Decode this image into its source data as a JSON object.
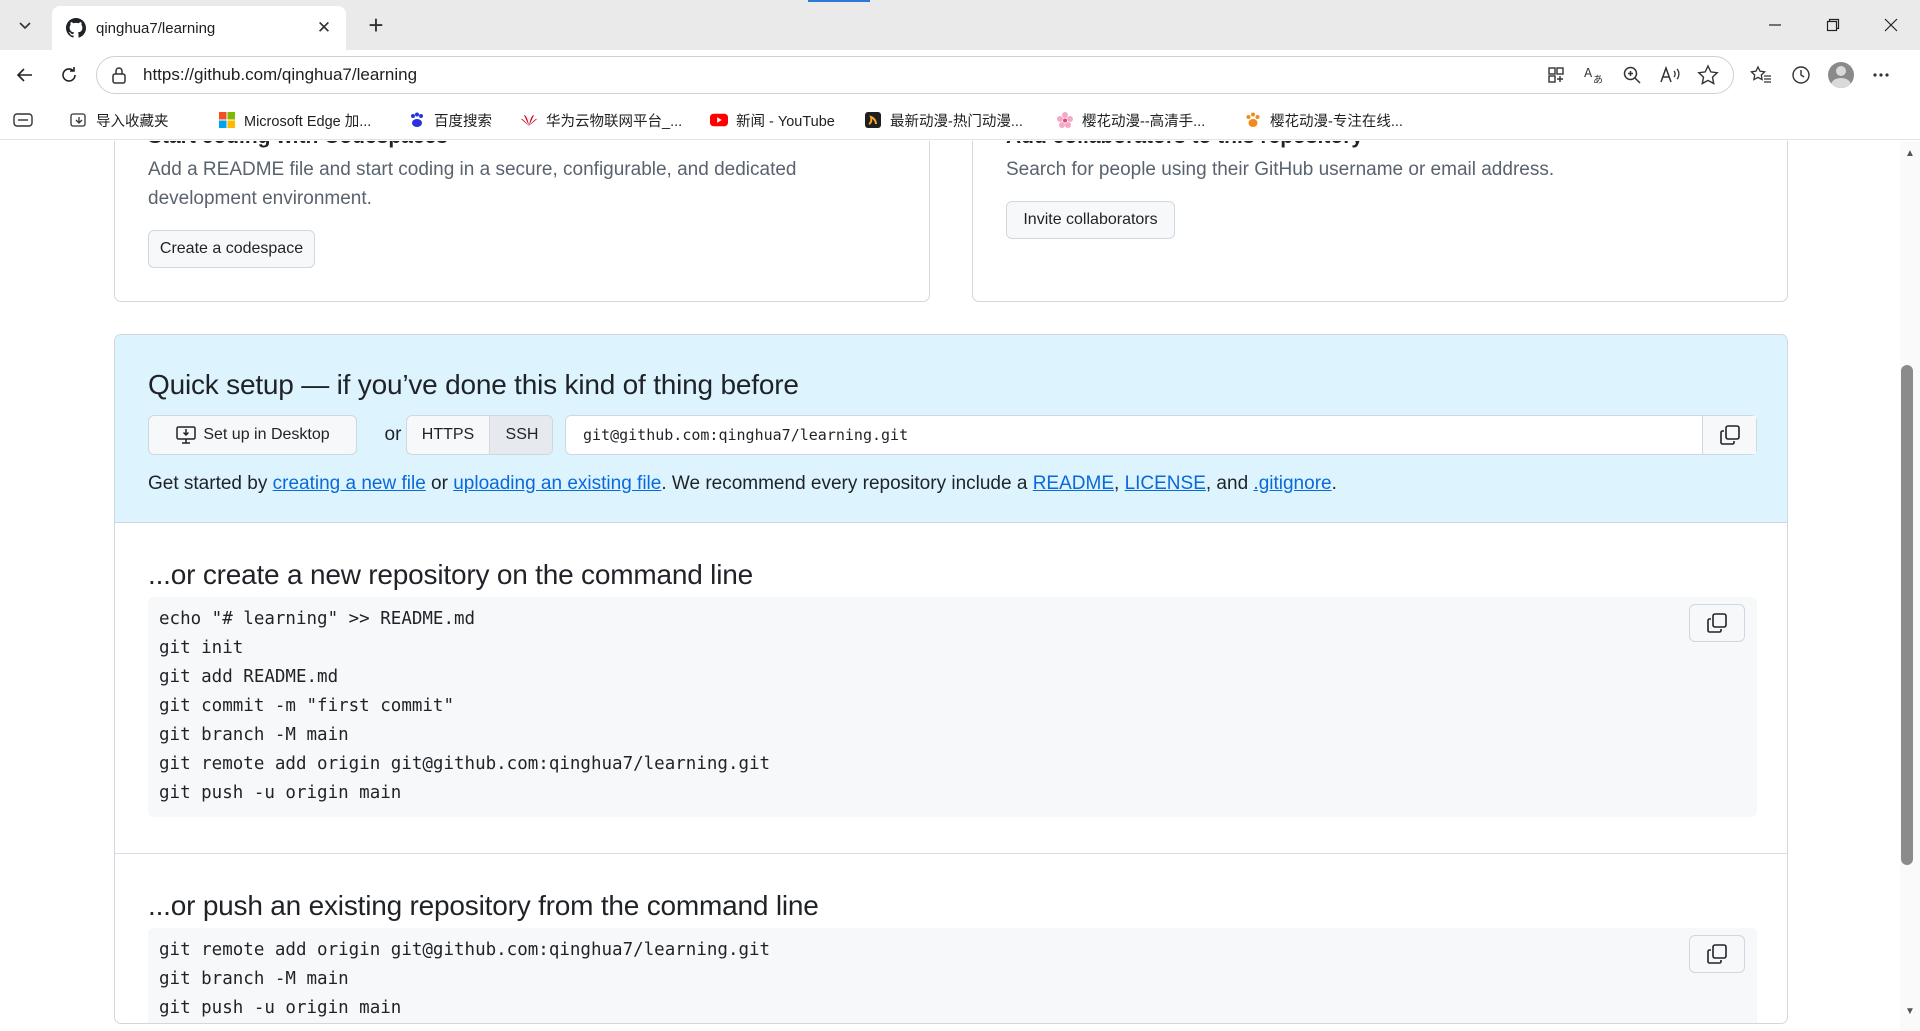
{
  "browser": {
    "tab_title": "qinghua7/learning",
    "url": "https://github.com/qinghua7/learning",
    "bookmarks": [
      {
        "label": "导入收藏夹",
        "icon": "import-favorites-icon"
      },
      {
        "label": "Microsoft Edge 加...",
        "icon": "microsoft-logo-icon"
      },
      {
        "label": "百度搜索",
        "icon": "baidu-paw-icon"
      },
      {
        "label": "华为云物联网平台_...",
        "icon": "huawei-logo-icon"
      },
      {
        "label": "新闻 - YouTube",
        "icon": "youtube-logo-icon"
      },
      {
        "label": "最新动漫-热门动漫...",
        "icon": "anime-site-icon"
      },
      {
        "label": "樱花动漫--高清手...",
        "icon": "sakura-flower-icon"
      },
      {
        "label": "樱花动漫-专注在线...",
        "icon": "paw-icon"
      }
    ]
  },
  "cards": {
    "codespaces": {
      "title": "Start coding with Codespaces",
      "desc_line1": "Add a README file and start coding in a secure, configurable, and dedicated",
      "desc_line2": "development environment.",
      "button": "Create a codespace"
    },
    "collaborators": {
      "title": "Add collaborators to this repository",
      "desc": "Search for people using their GitHub username or email address.",
      "button": "Invite collaborators"
    }
  },
  "quick_setup": {
    "title": "Quick setup — if you’ve done this kind of thing before",
    "desktop_button": "Set up in Desktop",
    "or": "or",
    "protocols": [
      "HTTPS",
      "SSH"
    ],
    "selected_protocol": "SSH",
    "clone_url": "git@github.com:qinghua7/learning.git",
    "intro": {
      "p1": "Get started by ",
      "link1": "creating a new file",
      "p2": " or ",
      "link2": "uploading an existing file",
      "p3": ". We recommend every repository include a ",
      "link3": "README",
      "p4": ", ",
      "link4": "LICENSE",
      "p5": ", and ",
      "link5": ".gitignore",
      "p6": "."
    }
  },
  "create_section": {
    "title": "...or create a new repository on the command line",
    "lines": [
      "echo \"# learning\" >> README.md",
      "git init",
      "git add README.md",
      "git commit -m \"first commit\"",
      "git branch -M main",
      "git remote add origin git@github.com:qinghua7/learning.git",
      "git push -u origin main"
    ]
  },
  "push_section": {
    "title": "...or push an existing repository from the command line",
    "lines": [
      "git remote add origin git@github.com:qinghua7/learning.git",
      "git branch -M main",
      "git push -u origin main"
    ]
  }
}
